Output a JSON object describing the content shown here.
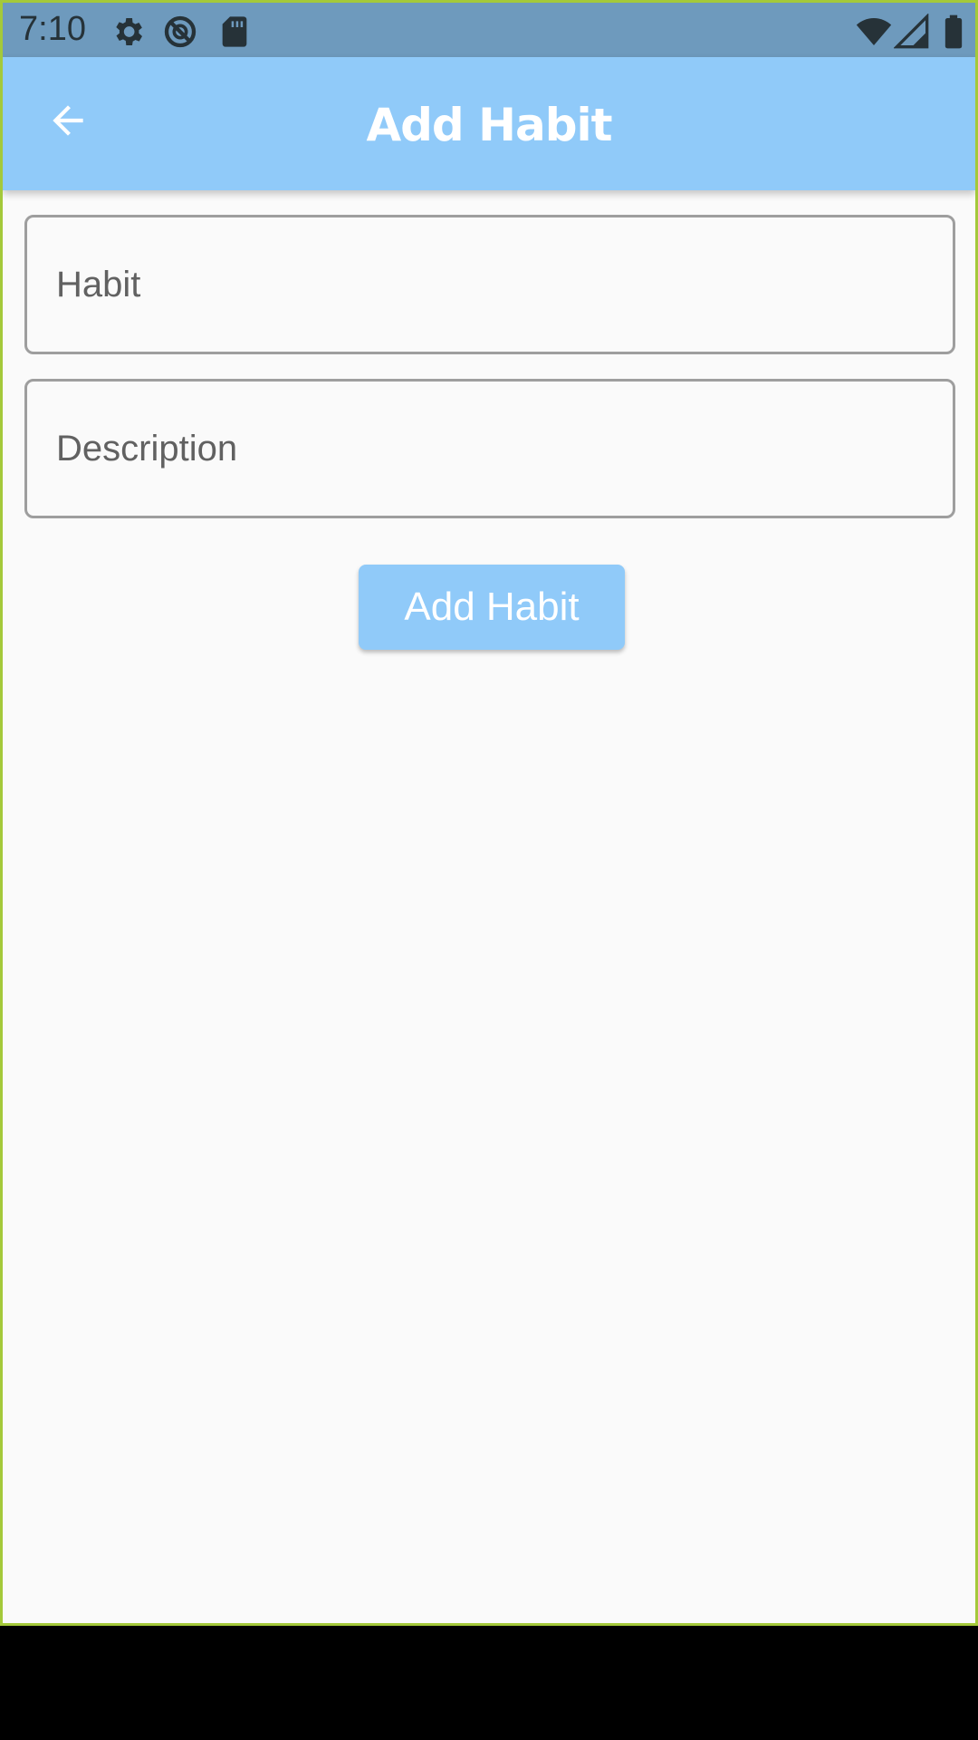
{
  "status_bar": {
    "time": "7:10",
    "left_icons": [
      "gear-icon",
      "do-not-disturb-icon",
      "sd-card-icon"
    ],
    "right_icons": [
      "wifi-icon",
      "signal-icon",
      "battery-icon"
    ]
  },
  "app_bar": {
    "back_icon": "arrow-back-icon",
    "title": "Add Habit"
  },
  "form": {
    "habit_field": {
      "placeholder": "Habit",
      "value": ""
    },
    "description_field": {
      "placeholder": "Description",
      "value": ""
    },
    "submit_label": "Add Habit"
  },
  "colors": {
    "status_bar": "#6e9abd",
    "app_bar": "#90caf9",
    "background": "#fafafa",
    "field_border": "#9e9e9e",
    "button": "#90caf9"
  }
}
